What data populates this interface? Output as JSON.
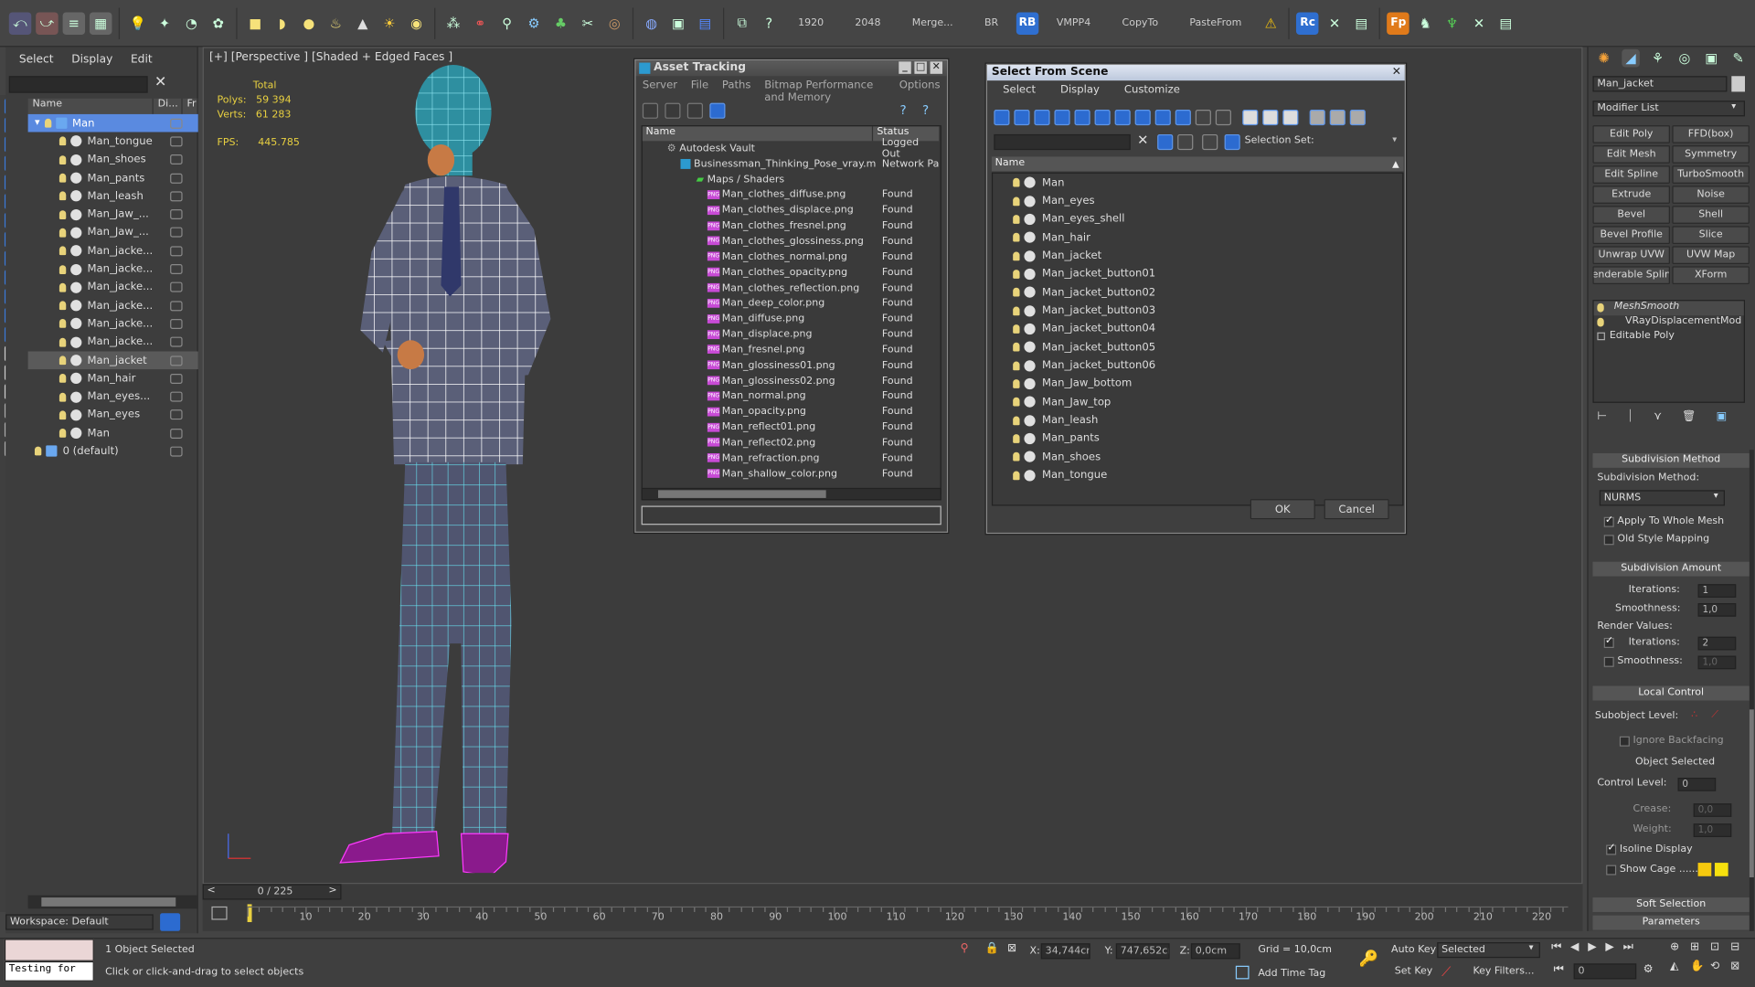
{
  "toolbar": {
    "items": [
      "1920",
      "2048",
      "Merge...",
      "BR",
      "RB",
      "VMPP4",
      "CopyTo",
      "PasteFrom",
      "Rc",
      "Fp"
    ]
  },
  "scene_explorer": {
    "menu": [
      "Select",
      "Display",
      "Edit"
    ],
    "col_name": "Name",
    "col_display": "Di...",
    "col_frozen": "Fr",
    "items": [
      {
        "label": "Man",
        "indent": 0,
        "selected": true
      },
      {
        "label": "Man_tongue",
        "indent": 1
      },
      {
        "label": "Man_shoes",
        "indent": 1
      },
      {
        "label": "Man_pants",
        "indent": 1
      },
      {
        "label": "Man_leash",
        "indent": 1
      },
      {
        "label": "Man_Jaw_...",
        "indent": 1
      },
      {
        "label": "Man_Jaw_...",
        "indent": 1
      },
      {
        "label": "Man_jacke...",
        "indent": 1
      },
      {
        "label": "Man_jacke...",
        "indent": 1
      },
      {
        "label": "Man_jacke...",
        "indent": 1
      },
      {
        "label": "Man_jacke...",
        "indent": 1
      },
      {
        "label": "Man_jacke...",
        "indent": 1
      },
      {
        "label": "Man_jacke...",
        "indent": 1
      },
      {
        "label": "Man_jacket",
        "indent": 1,
        "highlight": true
      },
      {
        "label": "Man_hair",
        "indent": 1
      },
      {
        "label": "Man_eyes...",
        "indent": 1
      },
      {
        "label": "Man_eyes",
        "indent": 1
      },
      {
        "label": "Man",
        "indent": 1
      },
      {
        "label": "0 (default)",
        "indent": 0
      }
    ],
    "workspace": "Workspace: Default"
  },
  "viewport": {
    "label": "[+] [Perspective ] [Shaded + Edged Faces ]",
    "stats": {
      "total": "Total",
      "polys_label": "Polys:",
      "polys": "59 394",
      "verts_label": "Verts:",
      "verts": "61 283",
      "fps_label": "FPS:",
      "fps": "445.785"
    }
  },
  "asset_tracking": {
    "title": "Asset Tracking",
    "menu": [
      "Server",
      "File",
      "Paths",
      "Bitmap Performance and Memory",
      "Options"
    ],
    "col_name": "Name",
    "col_status": "Status",
    "vault": "Autodesk Vault",
    "vault_status": "Logged Out",
    "file": "Businessman_Thinking_Pose_vray.max",
    "file_status": "Network Pa",
    "maps": "Maps / Shaders",
    "files": [
      "Man_clothes_diffuse.png",
      "Man_clothes_displace.png",
      "Man_clothes_fresnel.png",
      "Man_clothes_glossiness.png",
      "Man_clothes_normal.png",
      "Man_clothes_opacity.png",
      "Man_clothes_reflection.png",
      "Man_deep_color.png",
      "Man_diffuse.png",
      "Man_displace.png",
      "Man_fresnel.png",
      "Man_glossiness01.png",
      "Man_glossiness02.png",
      "Man_normal.png",
      "Man_opacity.png",
      "Man_reflect01.png",
      "Man_reflect02.png",
      "Man_refraction.png",
      "Man_shallow_color.png"
    ],
    "found": "Found",
    "png": "PNG"
  },
  "select_from_scene": {
    "title": "Select From Scene",
    "menu": [
      "Select",
      "Display",
      "Customize"
    ],
    "selection_set": "Selection Set:",
    "col_name": "Name",
    "items": [
      "Man",
      "Man_eyes",
      "Man_eyes_shell",
      "Man_hair",
      "Man_jacket",
      "Man_jacket_button01",
      "Man_jacket_button02",
      "Man_jacket_button03",
      "Man_jacket_button04",
      "Man_jacket_button05",
      "Man_jacket_button06",
      "Man_Jaw_bottom",
      "Man_Jaw_top",
      "Man_leash",
      "Man_pants",
      "Man_shoes",
      "Man_tongue"
    ],
    "ok": "OK",
    "cancel": "Cancel"
  },
  "command_panel": {
    "object_name": "Man_jacket",
    "modifier_list": "Modifier List",
    "buttons": [
      "Edit Poly",
      "FFD(box)",
      "Edit Mesh",
      "Symmetry",
      "Edit Spline",
      "TurboSmooth",
      "Extrude",
      "Noise",
      "Bevel",
      "Shell",
      "Bevel Profile",
      "Slice",
      "Unwrap UVW",
      "UVW Map",
      "enderable Splin",
      "XForm"
    ],
    "stack": [
      "MeshSmooth",
      "VRayDisplacementMod",
      "Editable Poly"
    ],
    "subdiv_method_title": "Subdivision Method",
    "subdiv_method_label": "Subdivision Method:",
    "subdiv_method_value": "NURMS",
    "apply_whole": "Apply To Whole Mesh",
    "old_style": "Old Style Mapping",
    "subdiv_amount_title": "Subdivision Amount",
    "iterations_label": "Iterations:",
    "iterations": "1",
    "smoothness_label": "Smoothness:",
    "smoothness": "1,0",
    "render_values": "Render Values:",
    "r_iterations": "2",
    "r_smoothness": "1,0",
    "local_control_title": "Local Control",
    "subobject_level": "Subobject Level:",
    "ignore_backfacing": "Ignore Backfacing",
    "object_selected": "Object Selected",
    "control_level_label": "Control Level:",
    "control_level": "0",
    "crease_label": "Crease:",
    "crease": "0,0",
    "weight_label": "Weight:",
    "weight": "1,0",
    "isoline": "Isoline Display",
    "show_cage": "Show Cage ......",
    "soft_selection": "Soft Selection",
    "parameters": "Parameters"
  },
  "timeline": {
    "frame_counter": "0 / 225",
    "ticks": [
      "10",
      "20",
      "30",
      "40",
      "50",
      "60",
      "70",
      "80",
      "90",
      "100",
      "110",
      "120",
      "130",
      "140",
      "150",
      "160",
      "170",
      "180",
      "190",
      "200",
      "210",
      "220"
    ]
  },
  "status_bar": {
    "script": "Testing for",
    "selected": "1 Object Selected",
    "prompt": "Click or click-and-drag to select objects",
    "x_label": "X:",
    "x": "34,744cm",
    "y_label": "Y:",
    "y": "747,652cm",
    "z_label": "Z:",
    "z": "0,0cm",
    "grid": "Grid = 10,0cm",
    "add_time_tag": "Add Time Tag",
    "auto_key": "Auto Key",
    "set_key": "Set Key",
    "selected_dd": "Selected",
    "key_filters": "Key Filters...",
    "frame": "0"
  }
}
